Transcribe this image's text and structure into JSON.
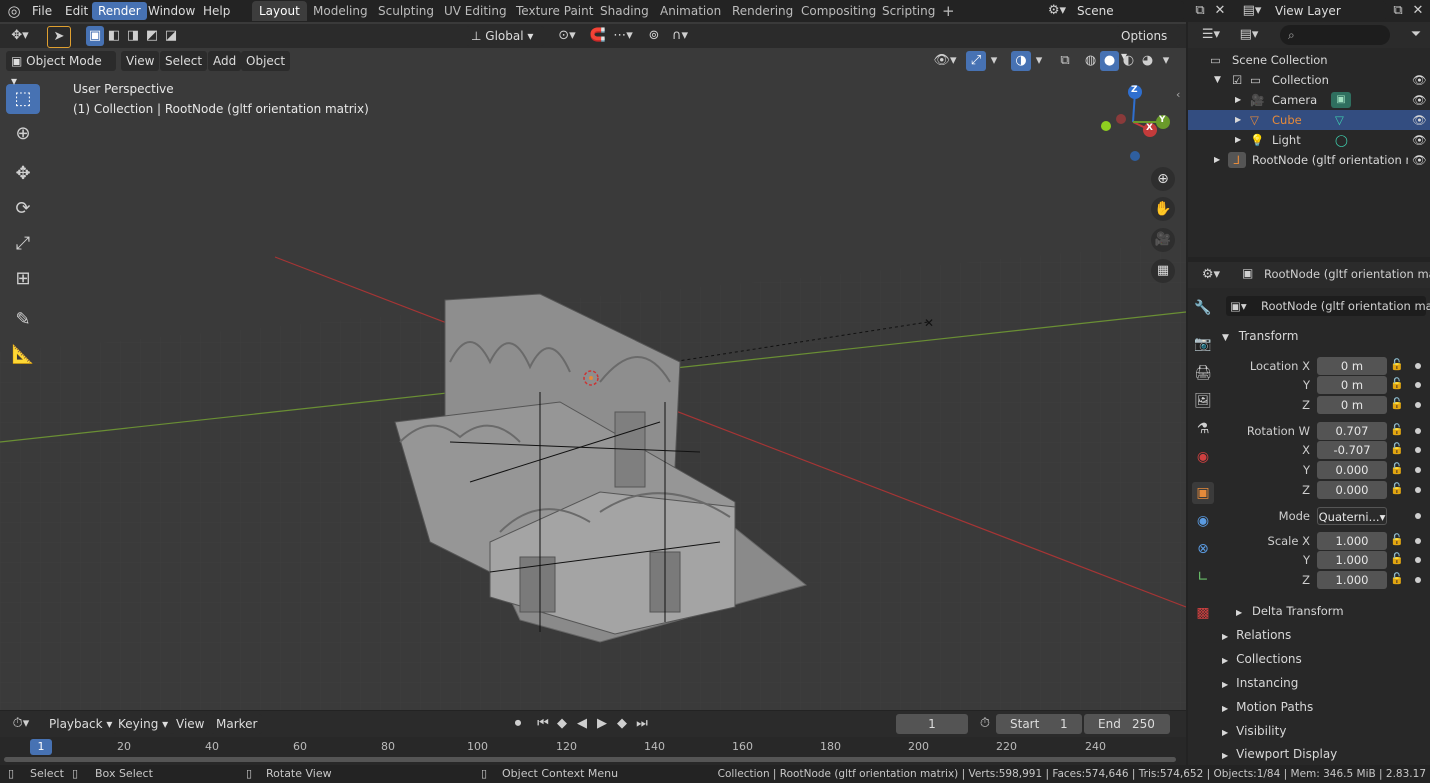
{
  "menubar": {
    "menus": [
      "File",
      "Edit",
      "Render",
      "Window",
      "Help"
    ],
    "active_menu": "Render",
    "workspaces": [
      "Layout",
      "Modeling",
      "Sculpting",
      "UV Editing",
      "Texture Paint",
      "Shading",
      "Animation",
      "Rendering",
      "Compositing",
      "Scripting"
    ],
    "active_workspace": "Layout",
    "add_workspace": "+",
    "scene": "Scene",
    "view_layer": "View Layer"
  },
  "toolheader": {
    "orientation": "Global",
    "options": "Options"
  },
  "viewport_header": {
    "mode": "Object Mode",
    "menus": [
      "View",
      "Select",
      "Add",
      "Object"
    ]
  },
  "viewport": {
    "perspective": "User Perspective",
    "context": "(1) Collection | RootNode (gltf orientation matrix)",
    "gizmo": {
      "x": "X",
      "y": "Y",
      "z": "Z"
    }
  },
  "outliner": {
    "rows": [
      {
        "label": "Scene Collection"
      },
      {
        "label": "Collection"
      },
      {
        "label": "Camera"
      },
      {
        "label": "Cube",
        "selected": true
      },
      {
        "label": "Light"
      },
      {
        "label": "RootNode (gltf orientation matr"
      }
    ]
  },
  "properties": {
    "header_object": "RootNode (gltf orientation matrix",
    "object_name": "RootNode (gltf orientation mat...",
    "transform_label": "Transform",
    "location": {
      "label": "Location X",
      "y_label": "Y",
      "z_label": "Z",
      "x": "0 m",
      "y": "0 m",
      "z": "0 m"
    },
    "rotation": {
      "label": "Rotation W",
      "x_label": "X",
      "y_label": "Y",
      "z_label": "Z",
      "w": "0.707",
      "x": "-0.707",
      "y": "0.000",
      "z": "0.000"
    },
    "mode_label": "Mode",
    "mode_value": "Quaterni...",
    "scale": {
      "label": "Scale X",
      "y_label": "Y",
      "z_label": "Z",
      "x": "1.000",
      "y": "1.000",
      "z": "1.000"
    },
    "delta_transform": "Delta Transform",
    "panels": [
      "Relations",
      "Collections",
      "Instancing",
      "Motion Paths",
      "Visibility",
      "Viewport Display"
    ]
  },
  "timeline": {
    "menus": [
      "Playback",
      "Keying",
      "View",
      "Marker"
    ],
    "current_frame": "1",
    "start_label": "Start",
    "start": "1",
    "end_label": "End",
    "end": "250",
    "ruler": [
      "1",
      "20",
      "40",
      "60",
      "80",
      "100",
      "120",
      "140",
      "160",
      "180",
      "200",
      "220",
      "240"
    ]
  },
  "statusbar": {
    "select": "Select",
    "box_select": "Box Select",
    "rotate_view": "Rotate View",
    "context_menu": "Object Context Menu",
    "stats": "Collection | RootNode (gltf orientation matrix) | Verts:598,991 | Faces:574,646 | Tris:574,652 | Objects:1/84 | Mem: 346.5 MiB | 2.83.17"
  },
  "colors": {
    "accent": "#4772b3",
    "selected_text": "#e58a3a",
    "x_axis": "#c33b3b",
    "y_axis": "#6a9a2a",
    "z_axis": "#2f6fcf"
  }
}
